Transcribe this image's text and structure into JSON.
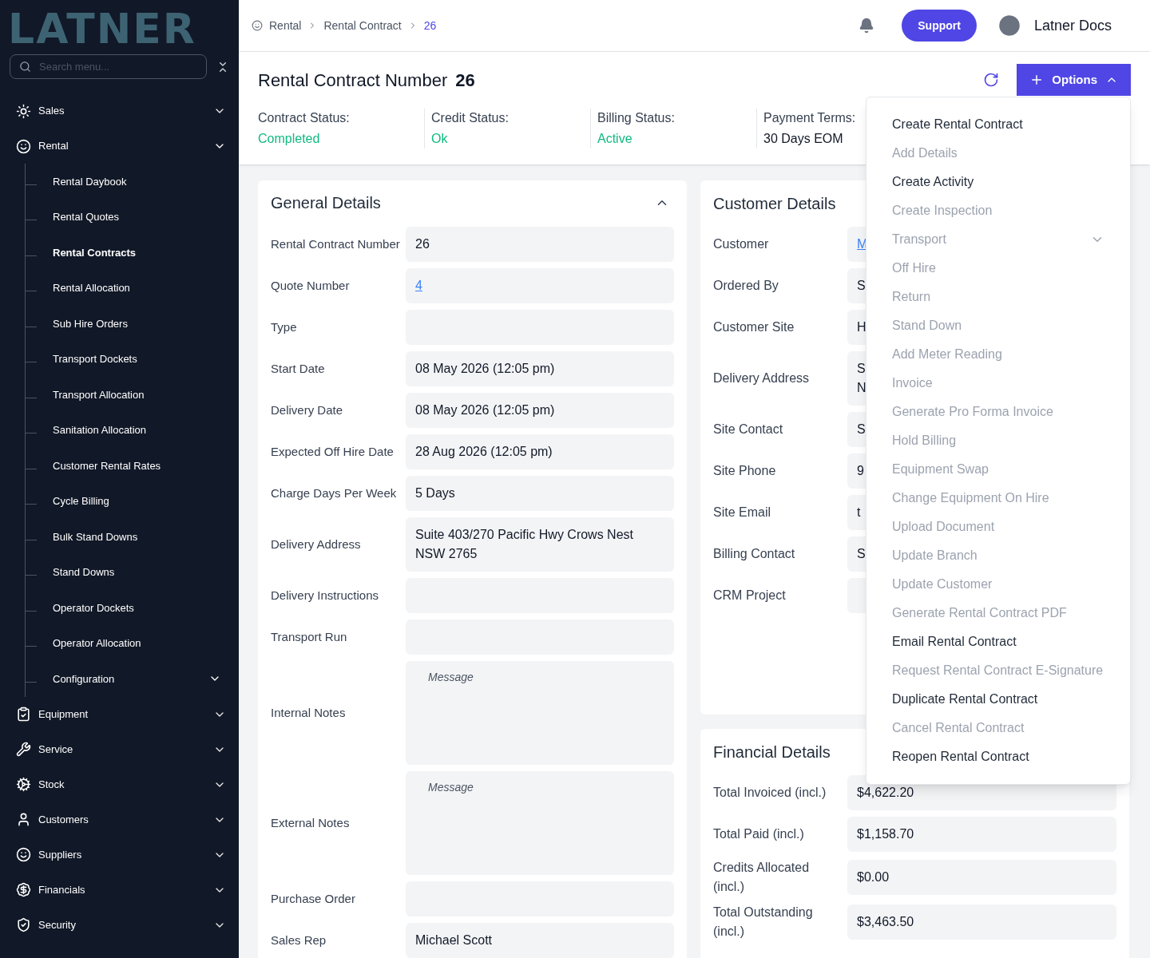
{
  "logo": {
    "text": "LATNER"
  },
  "sidebar": {
    "search": {
      "placeholder": "Search menu..."
    },
    "items": [
      {
        "label": "Sales",
        "expanded": false
      },
      {
        "label": "Rental",
        "expanded": true,
        "children": [
          {
            "label": "Rental Daybook",
            "kind": "link",
            "selected": false
          },
          {
            "label": "Rental Quotes",
            "kind": "link",
            "selected": false
          },
          {
            "label": "Rental Contracts",
            "kind": "link",
            "selected": true
          },
          {
            "label": "Rental Allocation",
            "kind": "link",
            "selected": false
          },
          {
            "label": "Sub Hire Orders",
            "kind": "link",
            "selected": false
          },
          {
            "label": "Transport Dockets",
            "kind": "link",
            "selected": false
          },
          {
            "label": "Transport Allocation",
            "kind": "link",
            "selected": false
          },
          {
            "label": "Sanitation Allocation",
            "kind": "link",
            "selected": false
          },
          {
            "label": "Customer Rental Rates",
            "kind": "link",
            "selected": false
          },
          {
            "label": "Cycle Billing",
            "kind": "link",
            "selected": false
          },
          {
            "label": "Bulk Stand Downs",
            "kind": "link",
            "selected": false
          },
          {
            "label": "Stand Downs",
            "kind": "link",
            "selected": false
          },
          {
            "label": "Operator Dockets",
            "kind": "link",
            "selected": false
          },
          {
            "label": "Operator Allocation",
            "kind": "link",
            "selected": false
          },
          {
            "label": "Configuration",
            "kind": "group",
            "selected": false
          }
        ]
      },
      {
        "label": "Equipment",
        "expanded": false
      },
      {
        "label": "Service",
        "expanded": false
      },
      {
        "label": "Stock",
        "expanded": false
      },
      {
        "label": "Customers",
        "expanded": false
      },
      {
        "label": "Suppliers",
        "expanded": false
      },
      {
        "label": "Financials",
        "expanded": false
      },
      {
        "label": "Security",
        "expanded": false
      }
    ]
  },
  "breadcrumb": [
    {
      "label": "Rental",
      "current": false
    },
    {
      "label": "Rental Contract",
      "current": false
    },
    {
      "label": "26",
      "current": true
    }
  ],
  "header": {
    "support": "Support",
    "user": "Latner Docs"
  },
  "title": {
    "label": "Rental Contract Number",
    "number": "26"
  },
  "statuses": [
    {
      "label": "Contract Status:",
      "value": "Completed",
      "color": "#10b981"
    },
    {
      "label": "Credit Status:",
      "value": "Ok",
      "color": "#10b981"
    },
    {
      "label": "Billing Status:",
      "value": "Active",
      "color": "#10b981"
    },
    {
      "label": "Payment Terms:",
      "value": "30 Days EOM",
      "color": "#111827"
    }
  ],
  "options": {
    "label": "Options",
    "expanded": true,
    "items": [
      {
        "label": "Create Rental Contract",
        "kind": "action",
        "disabled": false
      },
      {
        "label": "Add Details",
        "kind": "action",
        "disabled": true
      },
      {
        "label": "Create Activity",
        "kind": "action",
        "disabled": false
      },
      {
        "label": "Create Inspection",
        "kind": "action",
        "disabled": true
      },
      {
        "label": "Transport",
        "kind": "submenu",
        "disabled": true
      },
      {
        "label": "Off Hire",
        "kind": "action",
        "disabled": true
      },
      {
        "label": "Return",
        "kind": "action",
        "disabled": true
      },
      {
        "label": "Stand Down",
        "kind": "action",
        "disabled": true
      },
      {
        "label": "Add Meter Reading",
        "kind": "action",
        "disabled": true
      },
      {
        "label": "Invoice",
        "kind": "action",
        "disabled": true
      },
      {
        "label": "Generate Pro Forma Invoice",
        "kind": "action",
        "disabled": true
      },
      {
        "label": "Hold Billing",
        "kind": "action",
        "disabled": true
      },
      {
        "label": "Equipment Swap",
        "kind": "action",
        "disabled": true
      },
      {
        "label": "Change Equipment On Hire",
        "kind": "action",
        "disabled": true
      },
      {
        "label": "Upload Document",
        "kind": "action",
        "disabled": true
      },
      {
        "label": "Update Branch",
        "kind": "action",
        "disabled": true
      },
      {
        "label": "Update Customer",
        "kind": "action",
        "disabled": true
      },
      {
        "label": "Generate Rental Contract PDF",
        "kind": "action",
        "disabled": true
      },
      {
        "label": "Email Rental Contract",
        "kind": "action",
        "disabled": false
      },
      {
        "label": "Request Rental Contract E-Signature",
        "kind": "action",
        "disabled": true
      },
      {
        "label": "Duplicate Rental Contract",
        "kind": "action",
        "disabled": false
      },
      {
        "label": "Cancel Rental Contract",
        "kind": "action",
        "disabled": true
      },
      {
        "label": "Reopen Rental Contract",
        "kind": "action",
        "disabled": false
      }
    ]
  },
  "general": {
    "title": "General Details",
    "expanded": true,
    "fields": [
      {
        "label": "Rental Contract Number",
        "kind": "text",
        "value": "26"
      },
      {
        "label": "Quote Number",
        "kind": "link",
        "value": "4"
      },
      {
        "label": "Type",
        "kind": "text"
      },
      {
        "label": "Start Date",
        "kind": "text",
        "value": "08 May 2026 (12:05 pm)"
      },
      {
        "label": "Delivery Date",
        "kind": "text",
        "value": "08 May 2026 (12:05 pm)"
      },
      {
        "label": "Expected Off Hire Date",
        "kind": "text",
        "value": "28 Aug 2026 (12:05 pm)"
      },
      {
        "label": "Charge Days Per Week",
        "kind": "text",
        "value": "5 Days"
      },
      {
        "label": "Delivery Address",
        "kind": "text",
        "value": "Suite 403/270 Pacific Hwy Crows Nest NSW 2765"
      },
      {
        "label": "Delivery Instructions",
        "kind": "text"
      },
      {
        "label": "Transport Run",
        "kind": "text"
      },
      {
        "label": "Internal Notes",
        "kind": "textarea",
        "placeholder": "Message"
      },
      {
        "label": "External Notes",
        "kind": "textarea",
        "placeholder": "Message"
      },
      {
        "label": "Purchase Order",
        "kind": "text"
      },
      {
        "label": "Sales Rep",
        "kind": "text",
        "value": "Michael Scott"
      }
    ]
  },
  "customer": {
    "title": "Customer Details",
    "fields": [
      {
        "label": "Customer",
        "kind": "link",
        "lines": [
          "M"
        ]
      },
      {
        "label": "Ordered By",
        "kind": "text",
        "lines": [
          "S"
        ]
      },
      {
        "label": "Customer Site",
        "kind": "text",
        "lines": [
          "H"
        ]
      },
      {
        "label": "Delivery Address",
        "kind": "text",
        "lines": [
          "S",
          "N"
        ]
      },
      {
        "label": "Site Contact",
        "kind": "text",
        "lines": [
          "S"
        ]
      },
      {
        "label": "Site Phone",
        "kind": "text",
        "lines": [
          "9"
        ]
      },
      {
        "label": "Site Email",
        "kind": "text",
        "lines": [
          "t"
        ]
      },
      {
        "label": "Billing Contact",
        "kind": "text",
        "lines": [
          "S"
        ]
      },
      {
        "label": "CRM Project",
        "kind": "empty"
      }
    ]
  },
  "financial": {
    "title": "Financial Details",
    "fields": [
      {
        "label": "Total Invoiced (incl.)",
        "value": "$4,622.20"
      },
      {
        "label": "Total Paid (incl.)",
        "value": "$1,158.70"
      },
      {
        "label": "Credits Allocated (incl.)",
        "value": "$0.00"
      },
      {
        "label": "Total Outstanding (incl.)",
        "value": "$3,463.50"
      }
    ]
  }
}
